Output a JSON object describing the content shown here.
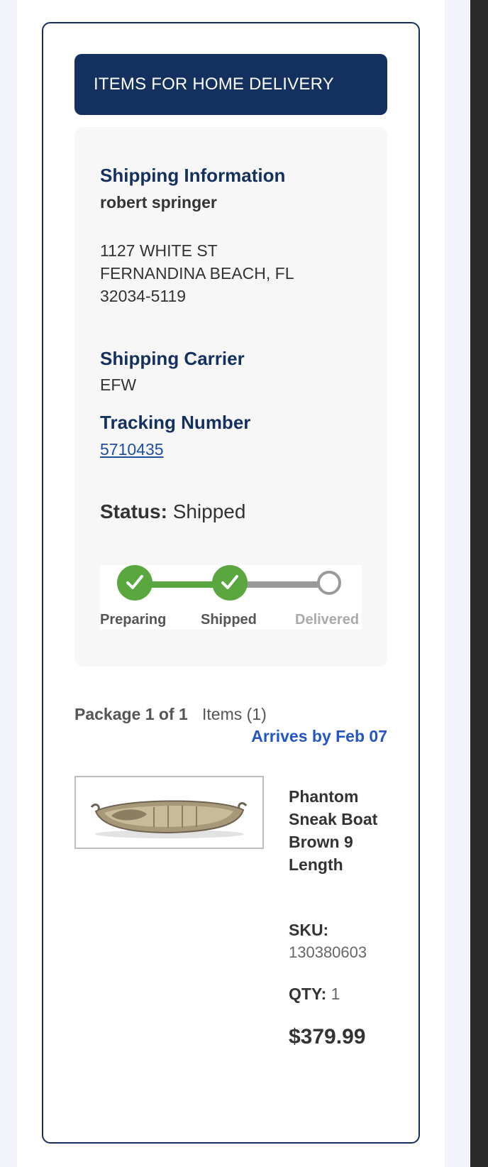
{
  "banner": {
    "title": "ITEMS FOR HOME DELIVERY"
  },
  "shipping": {
    "heading": "Shipping Information",
    "name": "robert springer",
    "address_line1": "1127 WHITE ST",
    "address_line2": "FERNANDINA BEACH, FL",
    "address_line3": "32034-5119",
    "carrier_heading": "Shipping Carrier",
    "carrier": "EFW",
    "tracking_heading": "Tracking Number",
    "tracking_number": "5710435",
    "status_label": "Status:",
    "status_value": "Shipped"
  },
  "progress": {
    "steps": [
      {
        "label": "Preparing",
        "state": "done"
      },
      {
        "label": "Shipped",
        "state": "done"
      },
      {
        "label": "Delivered",
        "state": "pending"
      }
    ],
    "colors": {
      "done": "#5aa63f",
      "pending": "#9a9a9a"
    }
  },
  "package": {
    "label": "Package 1 of 1",
    "items": "Items (1)",
    "arrives": "Arrives by Feb 07"
  },
  "product": {
    "image_icon": "boat-image",
    "name": "Phantom Sneak Boat Brown 9 Length",
    "sku_label": "SKU:",
    "sku": "130380603",
    "qty_label": "QTY:",
    "qty": "1",
    "price": "$379.99"
  },
  "colors": {
    "navy": "#14305f",
    "link": "#2356c4"
  }
}
